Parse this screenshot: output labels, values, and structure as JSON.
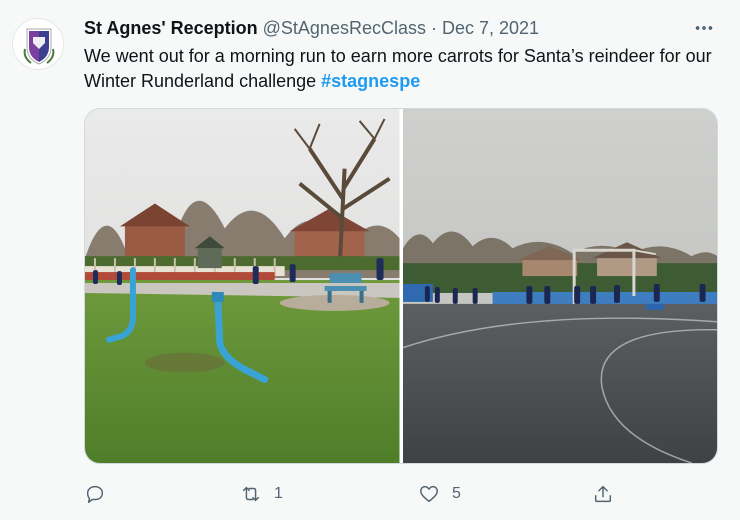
{
  "tweet": {
    "author_name": "St Agnes' Reception",
    "handle": "@StAgnesRecClass",
    "separator": "·",
    "date": "Dec 7, 2021",
    "text": "We went out for a morning run to earn more carrots for Santa’s reindeer for our Winter Runderland challenge",
    "hashtag": "#stagnespe",
    "hashtag_color": "#1d9bf0"
  },
  "media": {
    "photos": [
      {
        "semantic": "playground-grass-photo"
      },
      {
        "semantic": "playground-court-photo"
      }
    ]
  },
  "actions": {
    "reply": {
      "icon": "reply-icon",
      "count": ""
    },
    "retweet": {
      "icon": "retweet-icon",
      "count": "1"
    },
    "like": {
      "icon": "heart-icon",
      "count": "5"
    },
    "share": {
      "icon": "share-icon",
      "count": ""
    }
  },
  "colors": {
    "text": "#0f1419",
    "secondary": "#536471",
    "border": "#cfd9de"
  }
}
